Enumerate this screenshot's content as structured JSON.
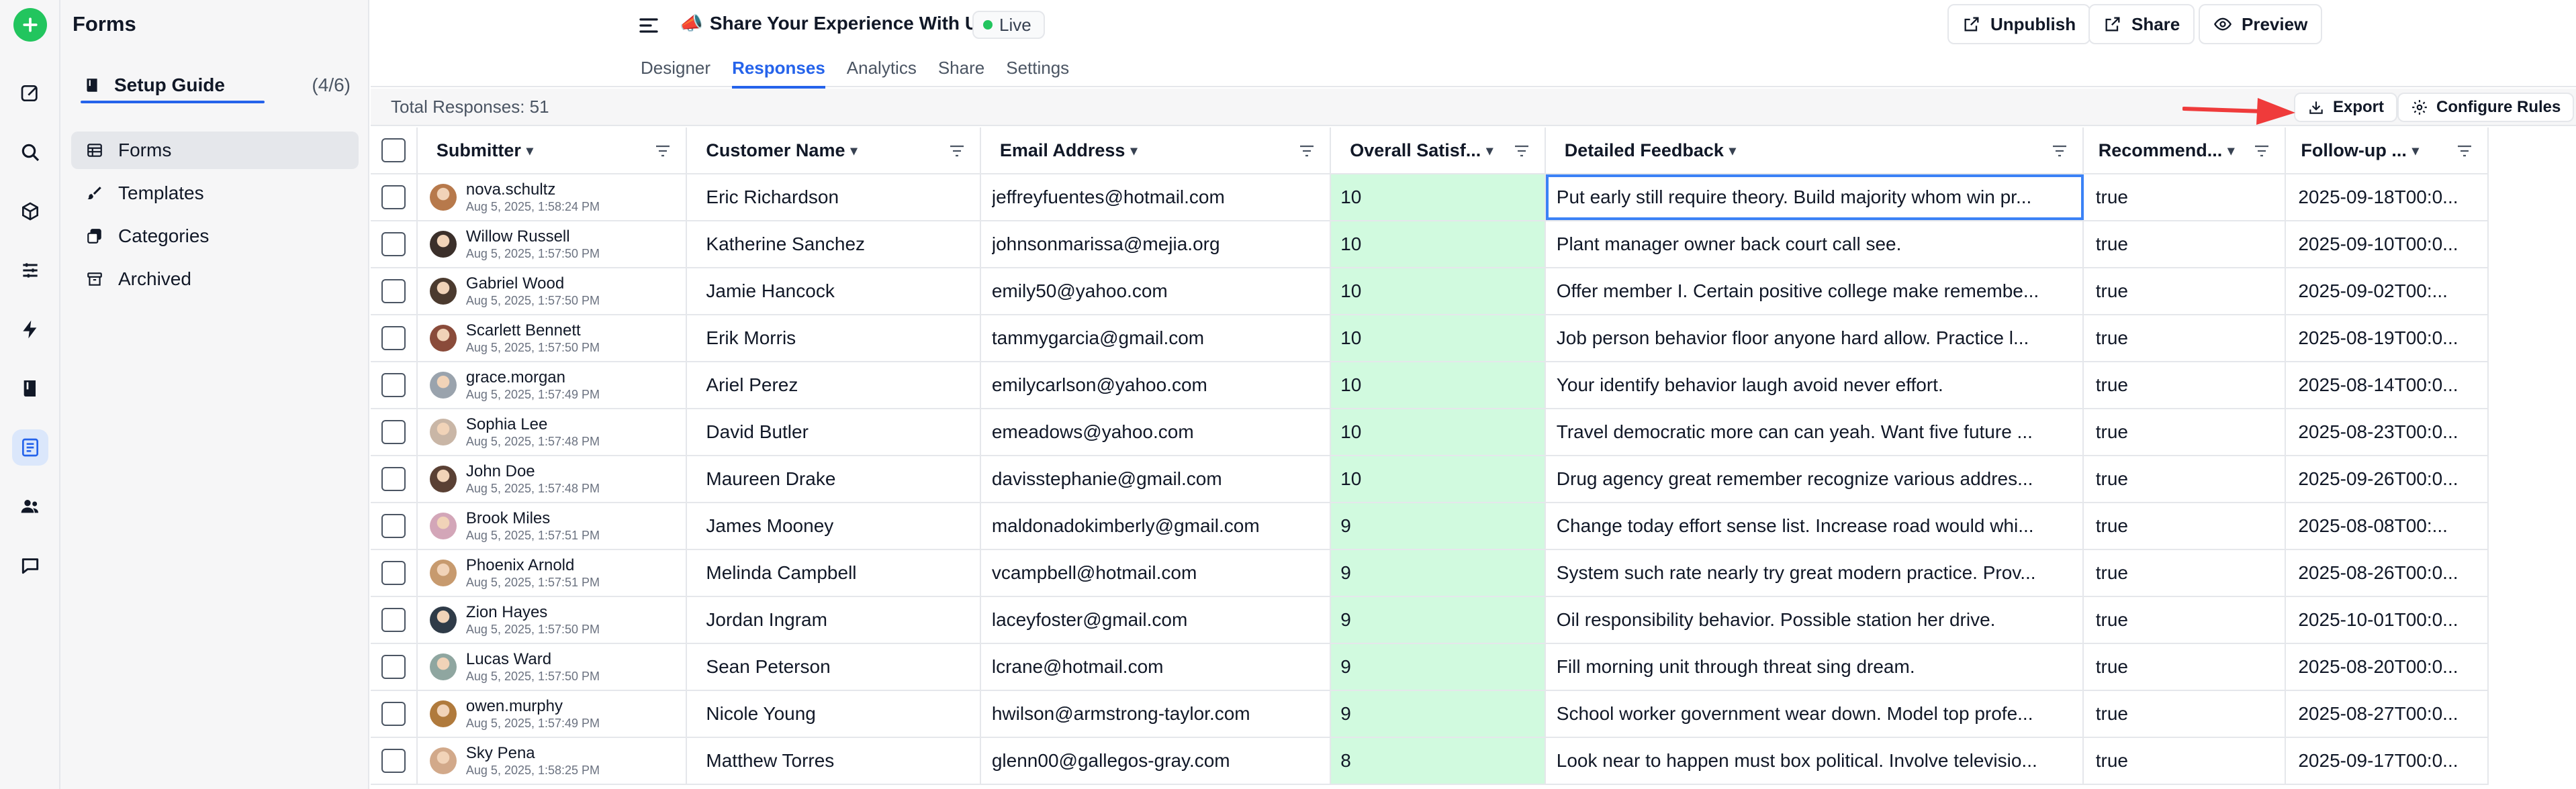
{
  "sidebar": {
    "title": "Forms",
    "setup_guide": {
      "label": "Setup Guide",
      "progress": "(4/6)"
    },
    "items": [
      {
        "label": "Forms",
        "icon": "table-icon",
        "active": true
      },
      {
        "label": "Templates",
        "icon": "brush-icon",
        "active": false
      },
      {
        "label": "Categories",
        "icon": "stack-icon",
        "active": false
      },
      {
        "label": "Archived",
        "icon": "archive-icon",
        "active": false
      }
    ]
  },
  "rail": {
    "icons": [
      "add-icon",
      "edit-icon",
      "search-icon",
      "cube-icon",
      "sliders-icon",
      "bolt-icon",
      "book-icon",
      "forms-icon",
      "users-icon",
      "chat-icon"
    ],
    "active": "forms-icon"
  },
  "header": {
    "emoji": "📣",
    "form_title": "Share Your Experience With Us",
    "status": "Live",
    "buttons": {
      "unpublish": "Unpublish",
      "share": "Share",
      "preview": "Preview"
    },
    "tabs": [
      "Designer",
      "Responses",
      "Analytics",
      "Share",
      "Settings"
    ],
    "active_tab": "Responses"
  },
  "toolbar": {
    "total": "Total Responses: 51",
    "export": "Export",
    "configure": "Configure Rules"
  },
  "table": {
    "columns": [
      "Submitter",
      "Customer Name",
      "Email Address",
      "Overall Satisf...",
      "Detailed Feedback",
      "Recommend...",
      "Follow-up ..."
    ],
    "rows": [
      {
        "submitter": "nova.schultz",
        "date": "Aug 5, 2025, 1:58:24 PM",
        "customer": "Eric Richardson",
        "email": "jeffreyfuentes@hotmail.com",
        "sat": "10",
        "feedback": "Put early still require theory. Build majority whom win pr...",
        "rec": "true",
        "follow": "2025-09-18T00:0..."
      },
      {
        "submitter": "Willow Russell",
        "date": "Aug 5, 2025, 1:57:50 PM",
        "customer": "Katherine Sanchez",
        "email": "johnsonmarissa@mejia.org",
        "sat": "10",
        "feedback": "Plant manager owner back court call see.",
        "rec": "true",
        "follow": "2025-09-10T00:0..."
      },
      {
        "submitter": "Gabriel Wood",
        "date": "Aug 5, 2025, 1:57:50 PM",
        "customer": "Jamie Hancock",
        "email": "emily50@yahoo.com",
        "sat": "10",
        "feedback": "Offer member I. Certain positive college make remembe...",
        "rec": "true",
        "follow": "2025-09-02T00:..."
      },
      {
        "submitter": "Scarlett Bennett",
        "date": "Aug 5, 2025, 1:57:50 PM",
        "customer": "Erik Morris",
        "email": "tammygarcia@gmail.com",
        "sat": "10",
        "feedback": "Job person behavior floor anyone hard allow. Practice l...",
        "rec": "true",
        "follow": "2025-08-19T00:0..."
      },
      {
        "submitter": "grace.morgan",
        "date": "Aug 5, 2025, 1:57:49 PM",
        "customer": "Ariel Perez",
        "email": "emilycarlson@yahoo.com",
        "sat": "10",
        "feedback": "Your identify behavior laugh avoid never effort.",
        "rec": "true",
        "follow": "2025-08-14T00:0..."
      },
      {
        "submitter": "Sophia Lee",
        "date": "Aug 5, 2025, 1:57:48 PM",
        "customer": "David Butler",
        "email": "emeadows@yahoo.com",
        "sat": "10",
        "feedback": "Travel democratic more can can yeah. Want five future ...",
        "rec": "true",
        "follow": "2025-08-23T00:0..."
      },
      {
        "submitter": "John Doe",
        "date": "Aug 5, 2025, 1:57:48 PM",
        "customer": "Maureen Drake",
        "email": "davisstephanie@gmail.com",
        "sat": "10",
        "feedback": "Drug agency great remember recognize various addres...",
        "rec": "true",
        "follow": "2025-09-26T00:0..."
      },
      {
        "submitter": "Brook Miles",
        "date": "Aug 5, 2025, 1:57:51 PM",
        "customer": "James Mooney",
        "email": "maldonadokimberly@gmail.com",
        "sat": "9",
        "feedback": "Change today effort sense list. Increase road would whi...",
        "rec": "true",
        "follow": "2025-08-08T00:..."
      },
      {
        "submitter": "Phoenix Arnold",
        "date": "Aug 5, 2025, 1:57:51 PM",
        "customer": "Melinda Campbell",
        "email": "vcampbell@hotmail.com",
        "sat": "9",
        "feedback": "System such rate nearly try great modern practice. Prov...",
        "rec": "true",
        "follow": "2025-08-26T00:0..."
      },
      {
        "submitter": "Zion Hayes",
        "date": "Aug 5, 2025, 1:57:50 PM",
        "customer": "Jordan Ingram",
        "email": "laceyfoster@gmail.com",
        "sat": "9",
        "feedback": "Oil responsibility behavior. Possible station her drive.",
        "rec": "true",
        "follow": "2025-10-01T00:0..."
      },
      {
        "submitter": "Lucas Ward",
        "date": "Aug 5, 2025, 1:57:50 PM",
        "customer": "Sean Peterson",
        "email": "lcrane@hotmail.com",
        "sat": "9",
        "feedback": "Fill morning unit through threat sing dream.",
        "rec": "true",
        "follow": "2025-08-20T00:0..."
      },
      {
        "submitter": "owen.murphy",
        "date": "Aug 5, 2025, 1:57:49 PM",
        "customer": "Nicole Young",
        "email": "hwilson@armstrong-taylor.com",
        "sat": "9",
        "feedback": "School worker government wear down. Model top profe...",
        "rec": "true",
        "follow": "2025-08-27T00:0..."
      },
      {
        "submitter": "Sky Pena",
        "date": "Aug 5, 2025, 1:58:25 PM",
        "customer": "Matthew Torres",
        "email": "glenn00@gallegos-gray.com",
        "sat": "8",
        "feedback": "Look near to happen must box political. Involve televisio...",
        "rec": "true",
        "follow": "2025-09-17T00:0..."
      }
    ],
    "avatar_colors": [
      "#b7794b",
      "#3b2f2a",
      "#4b3a2e",
      "#8a4b3a",
      "#9aa3ad",
      "#c9b6a6",
      "#5a4034",
      "#d3a6b8",
      "#c79a6e",
      "#2f3b48",
      "#8fa6a0",
      "#b07a3c",
      "#d2a98a"
    ]
  }
}
